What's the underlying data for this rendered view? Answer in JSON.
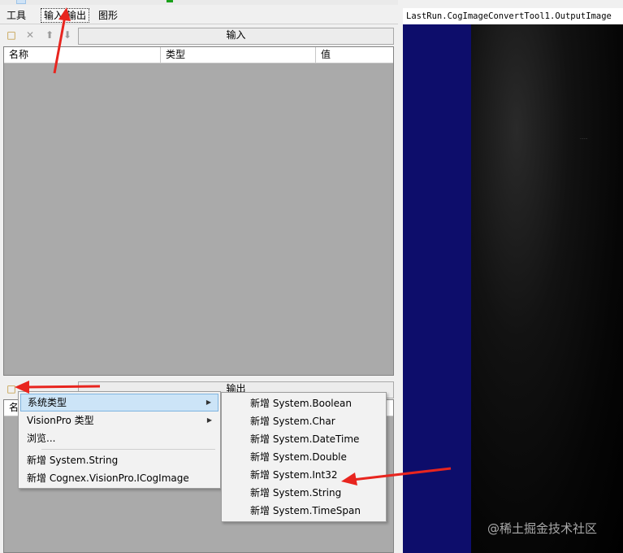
{
  "tabs": [
    {
      "label": "工具"
    },
    {
      "label": "输入/输出"
    },
    {
      "label": "图形"
    }
  ],
  "toolbar_icons": [
    "add-icon",
    "delete-icon",
    "move-up-icon",
    "move-down-icon"
  ],
  "input_section": {
    "label": "输入"
  },
  "output_section": {
    "label": "输出"
  },
  "grid_columns": [
    "名称",
    "类型",
    "值"
  ],
  "output_grid_partial_header": "名",
  "context_menu": {
    "items": [
      {
        "label": "系统类型",
        "has_submenu": true,
        "highlighted": true
      },
      {
        "label": "VisionPro 类型",
        "has_submenu": true
      },
      {
        "label": "浏览..."
      },
      {
        "label": "新增 System.String"
      },
      {
        "label": "新增 Cognex.VisionPro.ICogImage"
      }
    ]
  },
  "submenu": {
    "items": [
      {
        "label": "新增 System.Boolean"
      },
      {
        "label": "新增 System.Char"
      },
      {
        "label": "新增 System.DateTime"
      },
      {
        "label": "新增 System.Double"
      },
      {
        "label": "新增 System.Int32"
      },
      {
        "label": "新增 System.String"
      },
      {
        "label": "新增 System.TimeSpan"
      }
    ]
  },
  "image_display": {
    "title": "LastRun.CogImageConvertTool1.OutputImage"
  },
  "watermark": "@稀土掘金技术社区",
  "colors": {
    "annotation_red": "#e8251f",
    "menu_highlight": "#cce4f7",
    "image_blue": "#0d0d6b",
    "grid_gray": "#aaaaaa"
  }
}
